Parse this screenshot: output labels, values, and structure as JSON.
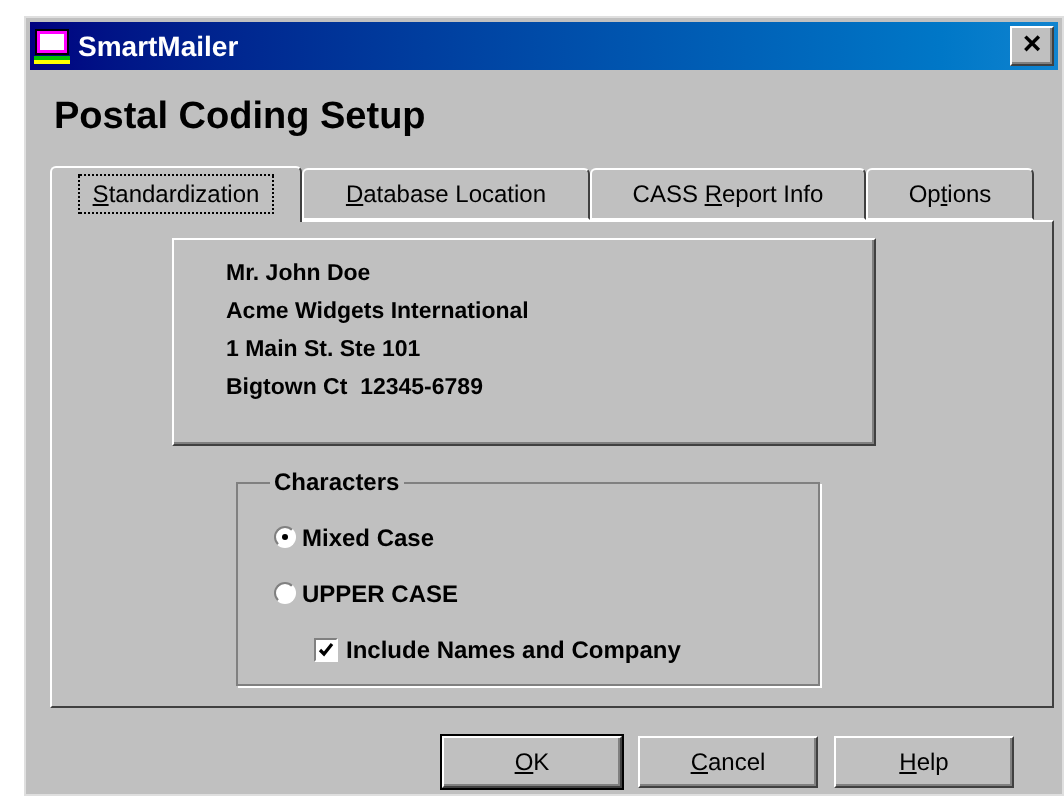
{
  "window": {
    "title": "SmartMailer",
    "close": "×"
  },
  "heading": "Postal Coding Setup",
  "tabs": [
    {
      "key": "S",
      "post": "tandardization",
      "selected": true
    },
    {
      "key": "D",
      "post": "atabase Location",
      "selected": false
    },
    {
      "pre": "CASS ",
      "key": "R",
      "post": "eport Info",
      "selected": false
    },
    {
      "pre": "Op",
      "key": "t",
      "post": "ions",
      "selected": false
    }
  ],
  "address": [
    "Mr. John Doe",
    "Acme Widgets International",
    "1 Main St. Ste 101",
    "Bigtown Ct  12345-6789"
  ],
  "characters": {
    "title": "Characters",
    "options": [
      {
        "kind": "radio",
        "label": "Mixed Case",
        "selected": true
      },
      {
        "kind": "radio",
        "label": "UPPER CASE",
        "selected": false
      },
      {
        "kind": "checkbox",
        "label": "Include Names and Company",
        "checked": true
      }
    ]
  },
  "buttons": [
    {
      "key": "O",
      "post": "K",
      "default": true
    },
    {
      "key": "C",
      "post": "ancel",
      "default": false
    },
    {
      "key": "H",
      "post": "elp",
      "default": false
    }
  ]
}
